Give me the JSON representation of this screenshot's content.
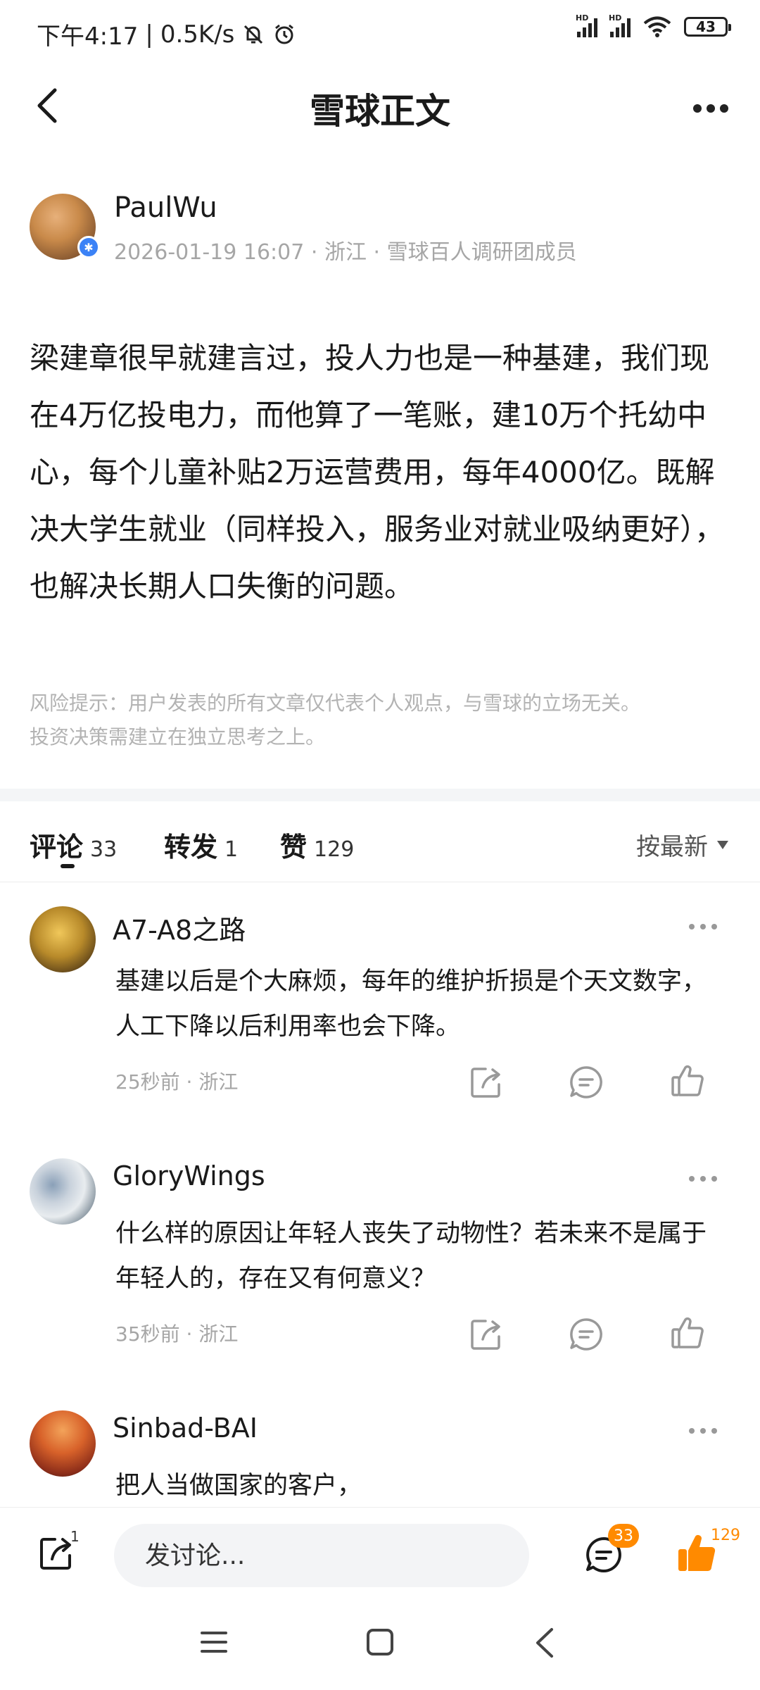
{
  "status_bar": {
    "time": "下午4:17",
    "network_speed": "0.5K/s",
    "signal_label_1": "HD",
    "signal_label_2": "HD",
    "battery": "43",
    "icons": [
      "mute-bell-icon",
      "alarm-icon",
      "signal-icon",
      "wifi-icon",
      "battery-icon"
    ]
  },
  "header": {
    "title": "雪球正文"
  },
  "author": {
    "name": "PaulWu",
    "date": "2026-01-19 16:07",
    "location": "浙江",
    "badge": "雪球百人调研团成员"
  },
  "article": {
    "text": "梁建章很早就建言过，投人力也是一种基建，我们现在4万亿投电力，而他算了一笔账，建10万个托幼中心，每个儿童补贴2万运营费用，每年4000亿。既解决大学生就业（同样投入，服务业对就业吸纳更好），也解决长期人口失衡的问题。",
    "disclaimer_line1": "风险提示：用户发表的所有文章仅代表个人观点，与雪球的立场无关。",
    "disclaimer_line2": "投资决策需建立在独立思考之上。"
  },
  "tabs": {
    "comments_label": "评论",
    "comments_count": "33",
    "reposts_label": "转发",
    "reposts_count": "1",
    "likes_label": "赞",
    "likes_count": "129",
    "sort_label": "按最新"
  },
  "comments": [
    {
      "name": "A7-A8之路",
      "text": "基建以后是个大麻烦，每年的维护折损是个天文数字，人工下降以后利用率也会下降。",
      "time": "25秒前",
      "location": "浙江"
    },
    {
      "name": "GloryWings",
      "text": "什么样的原因让年轻人丧失了动物性？若未来不是属于年轻人的，存在又有何意义？",
      "time": "35秒前",
      "location": "浙江"
    },
    {
      "name": "Sinbad-BAI",
      "text": "把人当做国家的客户，"
    }
  ],
  "bottom_bar": {
    "share_count": "1",
    "input_placeholder": "发讨论...",
    "comment_count": "33",
    "like_count": "129"
  },
  "colors": {
    "accent": "#ff8a00",
    "verify_blue": "#3b82f6",
    "meta_gray": "#a6a6a6"
  }
}
